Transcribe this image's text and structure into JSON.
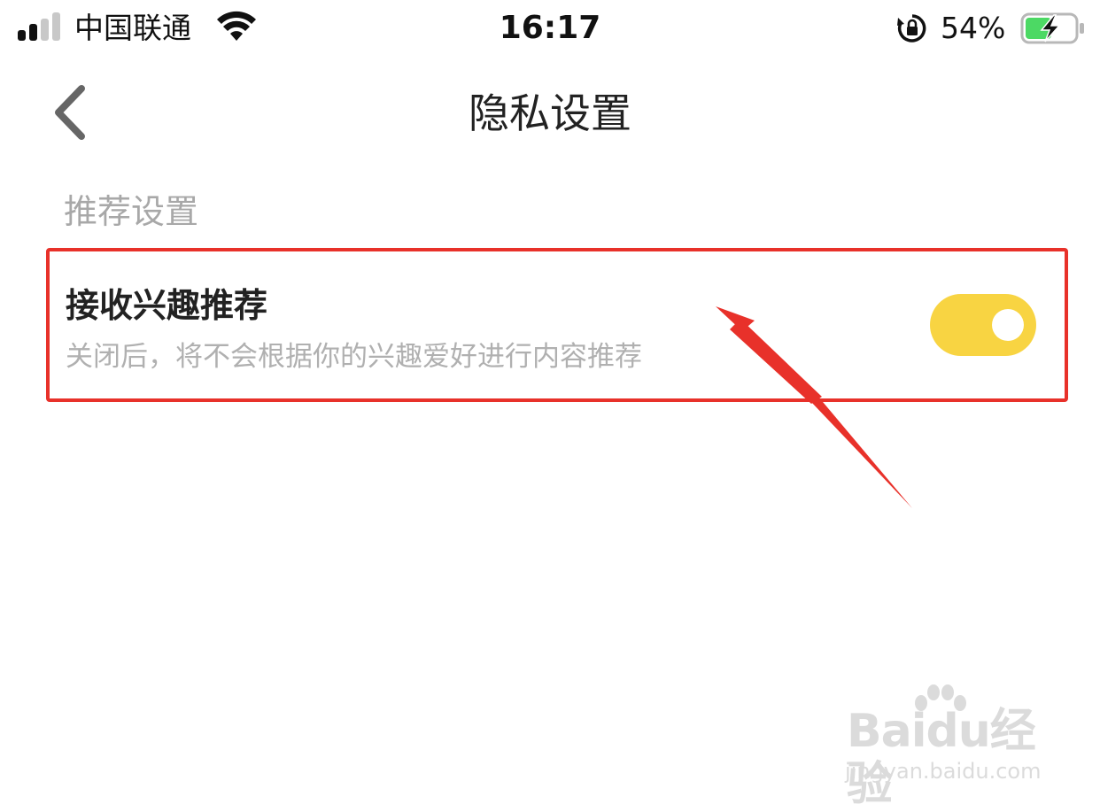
{
  "status_bar": {
    "carrier": "中国联通",
    "time": "16:17",
    "battery_percent": "54%",
    "battery_level": 0.54,
    "signal_bars_active": 2,
    "signal_bars_total": 4,
    "charging": true
  },
  "nav": {
    "title": "隐私设置",
    "back_icon": "chevron-left-icon"
  },
  "section": {
    "header": "推荐设置"
  },
  "setting": {
    "title": "接收兴趣推荐",
    "description": "关闭后，将不会根据你的兴趣爱好进行内容推荐",
    "enabled": true,
    "toggle_color": "#f8d442"
  },
  "annotation": {
    "highlight_color": "#e8312a",
    "arrow_color": "#e8312a"
  },
  "watermark": {
    "logo": "Baidu经验",
    "url": "jingyan.baidu.com"
  }
}
